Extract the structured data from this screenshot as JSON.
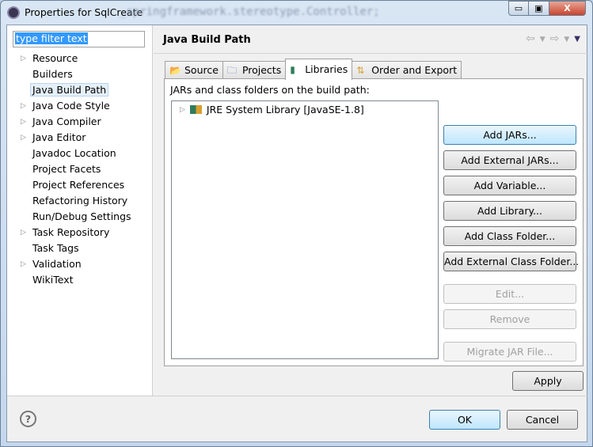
{
  "window": {
    "title": "Properties for SqlCreate",
    "background_text": "_springframework.stereotype.Controller;",
    "minimize": "▭",
    "maximize": "▣",
    "close": "X"
  },
  "sidebar": {
    "filter_value": "type filter text",
    "items": [
      {
        "label": "Resource",
        "expandable": true
      },
      {
        "label": "Builders",
        "expandable": false
      },
      {
        "label": "Java Build Path",
        "expandable": false,
        "selected": true
      },
      {
        "label": "Java Code Style",
        "expandable": true
      },
      {
        "label": "Java Compiler",
        "expandable": true
      },
      {
        "label": "Java Editor",
        "expandable": true
      },
      {
        "label": "Javadoc Location",
        "expandable": false
      },
      {
        "label": "Project Facets",
        "expandable": false
      },
      {
        "label": "Project References",
        "expandable": false
      },
      {
        "label": "Refactoring History",
        "expandable": false
      },
      {
        "label": "Run/Debug Settings",
        "expandable": false
      },
      {
        "label": "Task Repository",
        "expandable": true
      },
      {
        "label": "Task Tags",
        "expandable": false
      },
      {
        "label": "Validation",
        "expandable": true
      },
      {
        "label": "WikiText",
        "expandable": false
      }
    ]
  },
  "main": {
    "title": "Java Build Path",
    "tabs": [
      {
        "label": "Source",
        "icon": "source-folder-icon"
      },
      {
        "label": "Projects",
        "icon": "folder-icon"
      },
      {
        "label": "Libraries",
        "icon": "library-icon",
        "active": true
      },
      {
        "label": "Order and Export",
        "icon": "order-icon"
      }
    ],
    "panel_label": "JARs and class folders on the build path:",
    "entries": [
      {
        "label": "JRE System Library [JavaSE-1.8]",
        "icon": "library-icon"
      }
    ],
    "buttons": [
      {
        "label": "Add JARs...",
        "enabled": true,
        "default": true
      },
      {
        "label": "Add External JARs...",
        "enabled": true
      },
      {
        "label": "Add Variable...",
        "enabled": true
      },
      {
        "label": "Add Library...",
        "enabled": true
      },
      {
        "label": "Add Class Folder...",
        "enabled": true
      },
      {
        "label": "Add External Class Folder...",
        "enabled": true
      },
      {
        "label": "Edit...",
        "enabled": false
      },
      {
        "label": "Remove",
        "enabled": false
      },
      {
        "label": "Migrate JAR File...",
        "enabled": false
      }
    ],
    "apply": "Apply"
  },
  "footer": {
    "help": "?",
    "ok": "OK",
    "cancel": "Cancel"
  }
}
